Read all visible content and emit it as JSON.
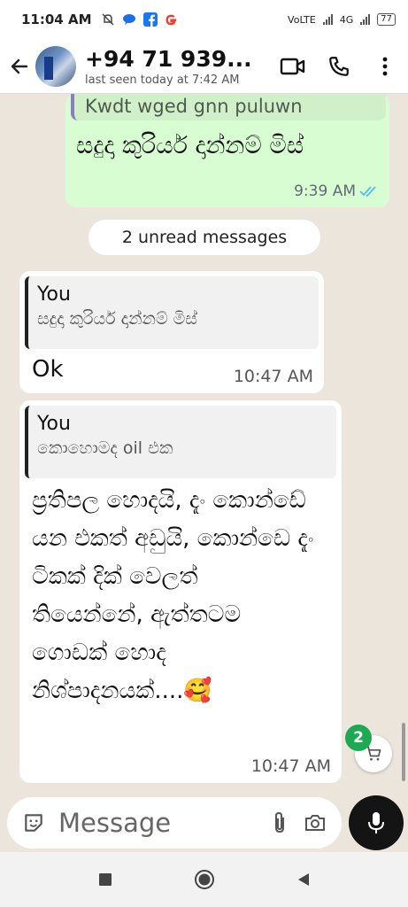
{
  "status_bar": {
    "time": "11:04 AM",
    "net1": "VoLTE",
    "net2": "4G",
    "battery": "77"
  },
  "header": {
    "contact_name": "+94 71 939...",
    "last_seen": "last seen today at 7:42 AM"
  },
  "chat": {
    "outgoing": {
      "quote_text": "Kwdt wged gnn puluwn",
      "text": "සදුදා කුරියර් දාන්නම් මිස්",
      "time": "9:39 AM"
    },
    "unread_label": "2 unread messages",
    "incoming": [
      {
        "quote_author": "You",
        "quote_text": "සදුදා කුරියර් දාන්නම් මිස්",
        "text": "Ok",
        "time": "10:47 AM"
      },
      {
        "quote_author": "You",
        "quote_text": "කොහොමද oil එක",
        "text": "ප්‍රතිපල හොදයි, දැං කොන්ඩේ යන එකත් අඩුයි, කොන්ඩෙ දැං ටිකක් දික් වෙලත් තියෙන්නේ, ඇත්තටම ගොඩක් හොද නිශ්පාදනයක්....🥰",
        "time": "10:47 AM"
      }
    ],
    "cart_badge": "2"
  },
  "composer": {
    "placeholder": "Message"
  },
  "colors": {
    "outgoing_bubble": "#d9fdd3",
    "incoming_bubble": "#ffffff",
    "chat_bg": "#ece5dc",
    "read_ticks": "#53bdeb",
    "badge": "#1da952"
  }
}
